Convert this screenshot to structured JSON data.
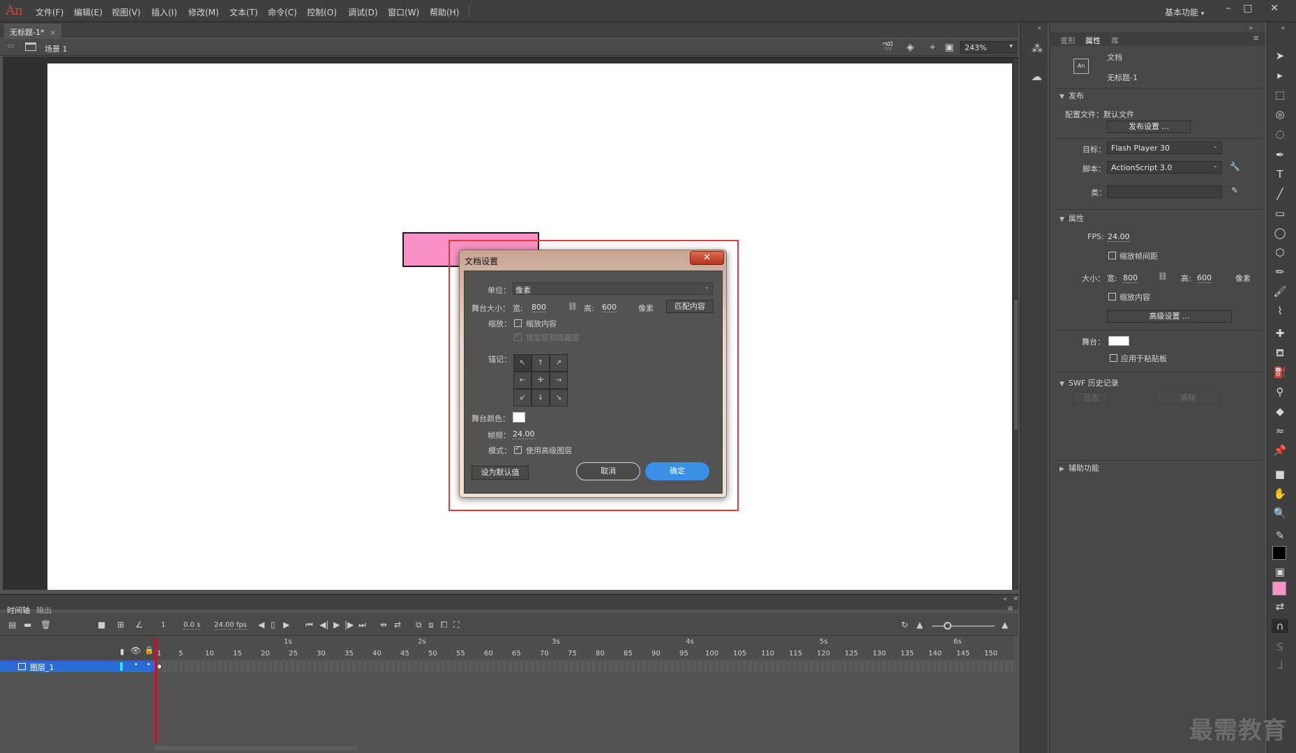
{
  "app": {
    "logo_text": "An"
  },
  "menu": [
    "文件(F)",
    "编辑(E)",
    "视图(V)",
    "插入(I)",
    "修改(M)",
    "文本(T)",
    "命令(C)",
    "控制(O)",
    "调试(D)",
    "窗口(W)",
    "帮助(H)"
  ],
  "workspace_label": "基本功能",
  "document_tab": {
    "title": "无标题-1*",
    "close": "×"
  },
  "editbar": {
    "scene": "场景 1",
    "zoom": "243%"
  },
  "dialog": {
    "title": "文档设置",
    "unit_label": "单位：",
    "unit_value": "像素",
    "stage_size_label": "舞台大小：",
    "width_label": "宽:",
    "width_value": "800",
    "height_label": "高:",
    "height_value": "600",
    "pixels_label": "像素",
    "match_button": "匹配内容",
    "scale_label": "缩放：",
    "scale_content": "缩放内容",
    "lock_hidden": "锁定层和隐藏层",
    "anchor_label": "锚记：",
    "stage_color_label": "舞台颜色：",
    "frame_rate_label": "帧频：",
    "frame_rate_value": "24.00",
    "mode_label": "模式：",
    "mode_value": "使用高级图层",
    "default_button": "设为默认值",
    "cancel_button": "取消",
    "ok_button": "确定",
    "colors": {
      "highlight": "#e4393c",
      "ok": "#3a8fe6"
    }
  },
  "timeline": {
    "tabs": [
      "时间轴",
      "输出"
    ],
    "current_frame": "1",
    "time": "0.0 s",
    "fps": "24.00 fps",
    "seconds": [
      "1s",
      "2s",
      "3s",
      "4s",
      "5s",
      "6s"
    ],
    "frames": [
      "1",
      "5",
      "10",
      "15",
      "20",
      "25",
      "30",
      "35",
      "40",
      "45",
      "50",
      "55",
      "60",
      "65",
      "70",
      "75",
      "80",
      "85",
      "90",
      "95",
      "100",
      "105",
      "110",
      "115",
      "120",
      "125",
      "130",
      "135",
      "140",
      "145",
      "150"
    ],
    "layer_name": "图层_1"
  },
  "properties": {
    "tabs": [
      "变形",
      "属性",
      "库"
    ],
    "doc_label": "文档",
    "doc_name": "无标题-1",
    "publish_section": "发布",
    "profile_label": "配置文件：默认文件",
    "publish_settings_btn": "发布设置 ...",
    "target_label": "目标：",
    "target_value": "Flash Player 30",
    "script_label": "脚本：",
    "script_value": "ActionScript 3.0",
    "class_label": "类：",
    "props_section": "属性",
    "fps_label": "FPS:",
    "fps_value": "24.00",
    "scale_spans": "缩放帧间距",
    "size_label": "大小：",
    "width_label": "宽:",
    "width_value": "800",
    "height_label": "高:",
    "height_value": "600",
    "pixels_label": "像素",
    "scale_content": "缩放内容",
    "advanced_btn": "高级设置 ...",
    "stage_label": "舞台：",
    "apply_paste": "应用于粘贴板",
    "swf_section": "SWF 历史记录",
    "log_btn": "日志",
    "clear_btn": "清除",
    "accessibility_section": "辅助功能"
  },
  "watermark": "最需教育"
}
